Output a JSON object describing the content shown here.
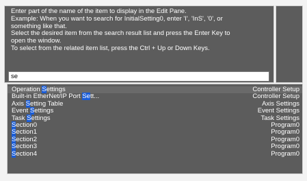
{
  "help": {
    "lines": [
      "Enter part of the name of the item to display in the Edit Pane.",
      "Example: When you want to search for InitialSetting0, enter 'I', 'InS', '0', or",
      "something like that.",
      "Select the desired item from the search result list and press the Enter Key to",
      "open the window.",
      "To select from the related item list, press the Ctrl + Up or Down Keys."
    ]
  },
  "search": {
    "value": "se"
  },
  "results": [
    {
      "pre": "Operation ",
      "hl": "S",
      "post": "ettings",
      "category": "Controller Setup"
    },
    {
      "pre": "Built-in EtherNet/IP Port ",
      "hl": "Se",
      "post": "tt...",
      "category": "Controller Setup"
    },
    {
      "pre": "Axis ",
      "hl": "S",
      "post": "etting Table",
      "category": "Axis Settings"
    },
    {
      "pre": "Event ",
      "hl": "S",
      "post": "ettings",
      "category": "Event Settings"
    },
    {
      "pre": "Task ",
      "hl": "S",
      "post": "ettings",
      "category": "Task Settings"
    },
    {
      "pre": "",
      "hl": "S",
      "post": "ection0",
      "category": "Program0"
    },
    {
      "pre": "",
      "hl": "S",
      "post": "ection1",
      "category": "Program0"
    },
    {
      "pre": "",
      "hl": "S",
      "post": "ection2",
      "category": "Program0"
    },
    {
      "pre": "",
      "hl": "S",
      "post": "ection3",
      "category": "Program0"
    },
    {
      "pre": "",
      "hl": "S",
      "post": "ection4",
      "category": "Program0"
    }
  ],
  "colors": {
    "highlight": "#1a5cd6",
    "panel": "#5c5c5c"
  }
}
